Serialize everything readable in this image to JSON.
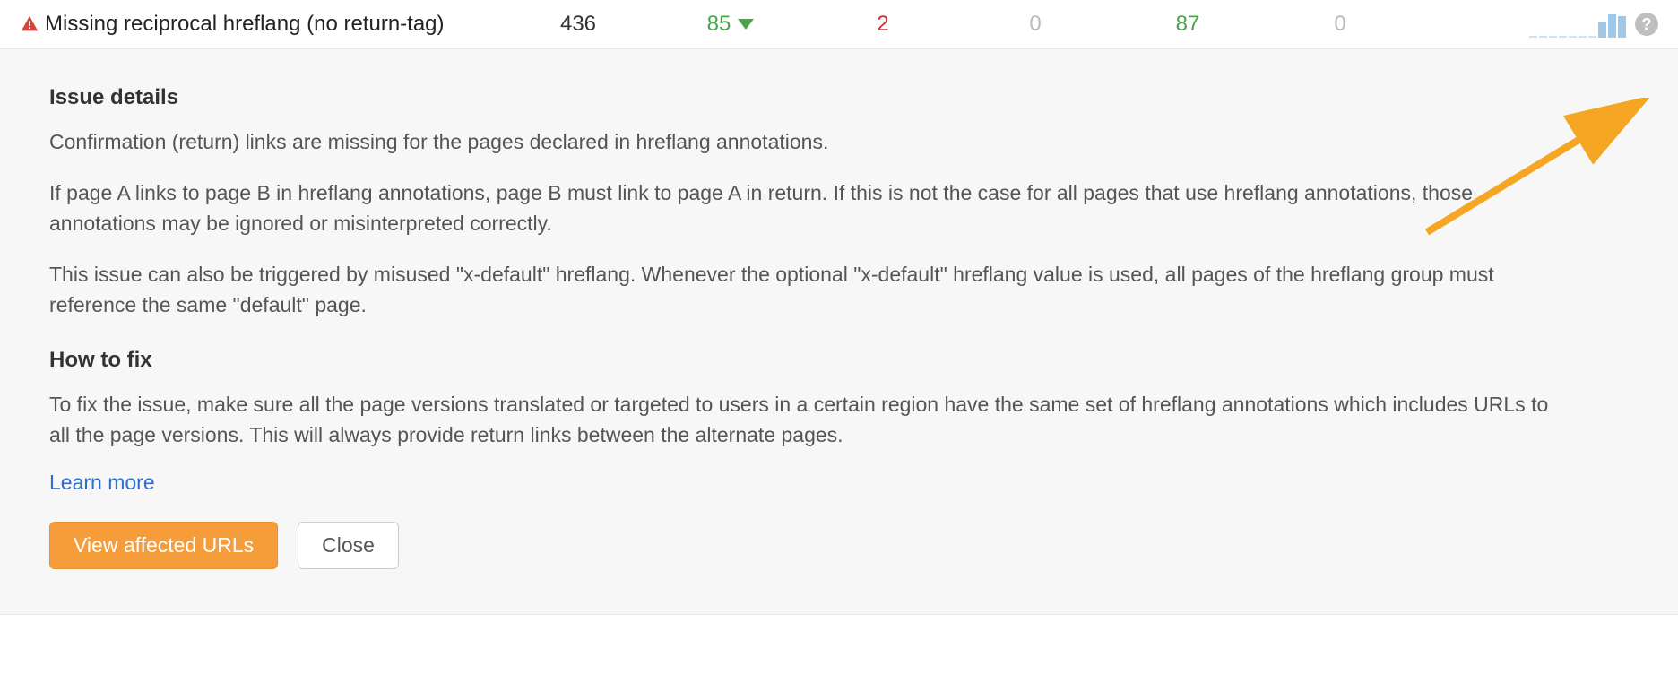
{
  "row": {
    "issue_name": "Missing reciprocal hreflang (no return-tag)",
    "metrics": {
      "m1": "436",
      "m2": "85",
      "m3": "2",
      "m4": "0",
      "m5": "87",
      "m6": "0"
    },
    "sparkline_heights": [
      2,
      2,
      2,
      2,
      2,
      2,
      2,
      18,
      26,
      24
    ]
  },
  "details": {
    "issue_details_heading": "Issue details",
    "p1": "Confirmation (return) links are missing for the pages declared in hreflang annotations.",
    "p2": "If page A links to page B in hreflang annotations, page B must link to page A in return. If this is not the case for all pages that use hreflang annotations, those annotations may be ignored or misinterpreted correctly.",
    "p3": "This issue can also be triggered by misused \"x-default\" hreflang. Whenever the optional \"x-default\" hreflang value is used, all pages of the hreflang group must reference the same \"default\" page.",
    "how_to_fix_heading": "How to fix",
    "p4": "To fix the issue, make sure all the page versions translated or targeted to users in a certain region have the same set of hreflang annotations which includes URLs to all the page versions. This will always provide return links between the alternate pages.",
    "learn_more": "Learn more",
    "view_affected": "View affected URLs",
    "close": "Close"
  },
  "icons": {
    "help_glyph": "?"
  }
}
